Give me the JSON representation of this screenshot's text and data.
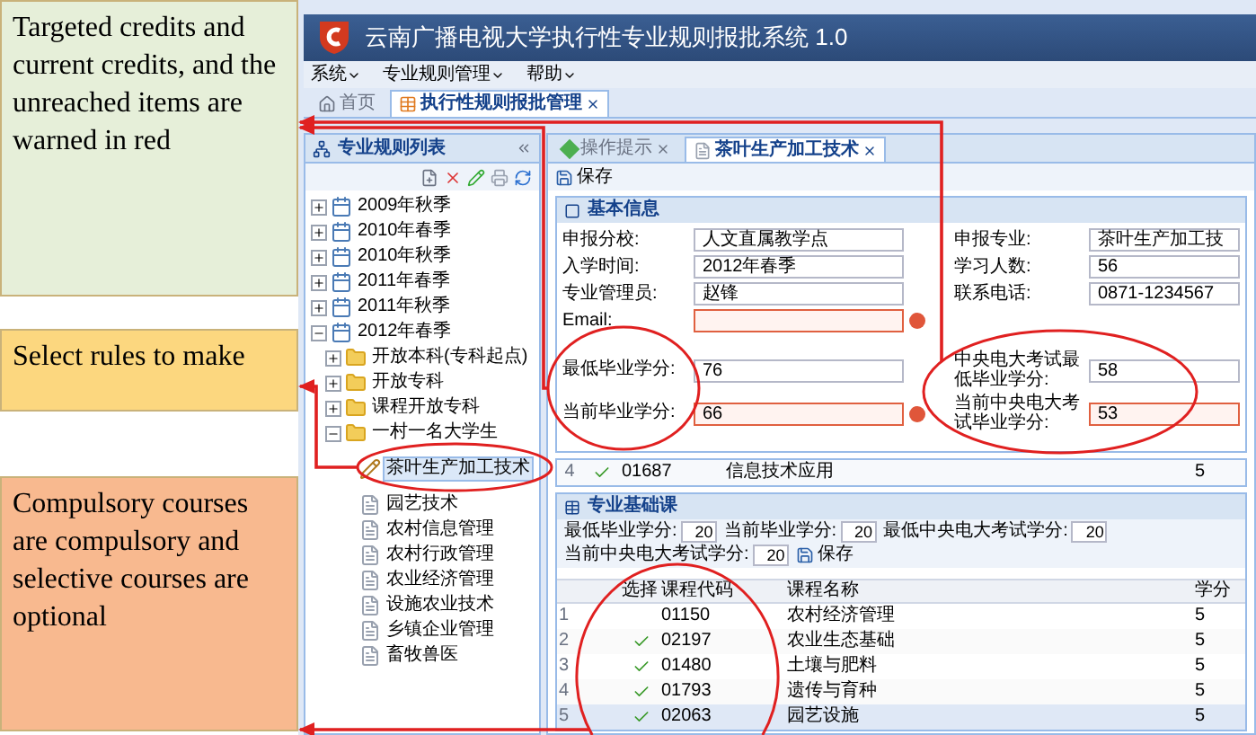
{
  "annotations": [
    {
      "text": "Targeted credits and current credits, and the unreached items are warned in red",
      "color": "#e6efd9"
    },
    {
      "text": "Select rules to make",
      "color": "#fcd77f"
    },
    {
      "text": "Compulsory courses are compulsory and selective courses are optional",
      "color": "#f8b98f"
    }
  ],
  "app": {
    "title": "云南广播电视大学执行性专业规则报批系统 1.0",
    "menu": [
      "系统",
      "专业规则管理",
      "帮助"
    ],
    "tabs": [
      {
        "label": "首页",
        "selected": false
      },
      {
        "label": "执行性规则报批管理",
        "selected": true
      }
    ],
    "left_panel": {
      "title": "专业规则列表",
      "tree": [
        {
          "label": "2009年秋季",
          "kind": "term",
          "expanded": false,
          "selected": false
        },
        {
          "label": "2010年春季",
          "kind": "term",
          "expanded": false,
          "selected": false
        },
        {
          "label": "2010年秋季",
          "kind": "term",
          "expanded": false,
          "selected": false
        },
        {
          "label": "2011年春季",
          "kind": "term",
          "expanded": false,
          "selected": false
        },
        {
          "label": "2011年秋季",
          "kind": "term",
          "expanded": false,
          "selected": false
        },
        {
          "label": "2012年春季",
          "kind": "term",
          "expanded": true,
          "selected": false,
          "children": [
            {
              "label": "开放本科(专科起点)",
              "kind": "folder",
              "expanded": false,
              "selected": false
            },
            {
              "label": "开放专科",
              "kind": "folder",
              "expanded": false,
              "selected": false
            },
            {
              "label": "课程开放专科",
              "kind": "folder",
              "expanded": false,
              "selected": false
            },
            {
              "label": "一村一名大学生",
              "kind": "folder",
              "expanded": true,
              "selected": false,
              "children": [
                {
                  "label": "茶叶生产加工技术",
                  "kind": "editing",
                  "selected": true
                },
                {
                  "label": "园艺技术",
                  "kind": "rule",
                  "selected": false
                },
                {
                  "label": "农村信息管理",
                  "kind": "rule",
                  "selected": false
                },
                {
                  "label": "农村行政管理",
                  "kind": "rule",
                  "selected": false
                },
                {
                  "label": "农业经济管理",
                  "kind": "rule",
                  "selected": false
                },
                {
                  "label": "设施农业技术",
                  "kind": "rule",
                  "selected": false
                },
                {
                  "label": "乡镇企业管理",
                  "kind": "rule",
                  "selected": false
                },
                {
                  "label": "畜牧兽医",
                  "kind": "rule",
                  "selected": false
                }
              ]
            }
          ]
        }
      ]
    },
    "main_tabs": [
      {
        "label": "操作提示",
        "selected": false
      },
      {
        "label": "茶叶生产加工技术",
        "selected": true
      }
    ],
    "save_label": "保存",
    "basic_info": {
      "title": "基本信息",
      "rows": [
        [
          {
            "label": "申报分校:",
            "value": "人文直属教学点",
            "error": false
          },
          {
            "label": "申报专业:",
            "value": "茶叶生产加工技",
            "error": false
          }
        ],
        [
          {
            "label": "入学时间:",
            "value": "2012年春季",
            "error": false
          },
          {
            "label": "学习人数:",
            "value": "56",
            "error": false
          }
        ],
        [
          {
            "label": "专业管理员:",
            "value": "赵锋",
            "error": false
          },
          {
            "label": "联系电话:",
            "value": "0871-1234567",
            "error": false
          }
        ],
        [
          {
            "label": "Email:",
            "error": true
          }
        ],
        [
          {
            "label": "最低毕业学分:",
            "value": "76",
            "error": false
          },
          {
            "label": "中央电大考试最低毕业学分:",
            "value": "58",
            "error": false
          }
        ],
        [
          {
            "label": "当前毕业学分:",
            "value": "66",
            "error": true
          },
          {
            "label": "当前中央电大考试毕业学分:",
            "value": "53",
            "error": true
          }
        ]
      ]
    },
    "prev_row": {
      "number": "4",
      "checked": true,
      "code": "01687",
      "name": "信息技术应用",
      "credit": "5"
    },
    "courses": {
      "title": "专业基础课",
      "filters": [
        {
          "label": "最低毕业学分:",
          "value": "20"
        },
        {
          "label": "当前毕业学分:",
          "value": "20"
        },
        {
          "label": "最低中央电大考试学分:",
          "value": "20"
        },
        {
          "label": "当前中央电大考试学分:",
          "value": "20"
        }
      ],
      "save_label": "保存",
      "columns": [
        "选择",
        "课程代码",
        "课程名称",
        "学分"
      ],
      "rows": [
        {
          "number": "1",
          "checked": false,
          "code": "01150",
          "name": "农村经济管理",
          "credit": "5",
          "selected": false
        },
        {
          "number": "2",
          "checked": true,
          "code": "02197",
          "name": "农业生态基础",
          "credit": "5",
          "selected": false
        },
        {
          "number": "3",
          "checked": true,
          "code": "01480",
          "name": "土壤与肥料",
          "credit": "5",
          "selected": false
        },
        {
          "number": "4",
          "checked": true,
          "code": "01793",
          "name": "遗传与育种",
          "credit": "5",
          "selected": false
        },
        {
          "number": "5",
          "checked": true,
          "code": "02063",
          "name": "园艺设施",
          "credit": "5",
          "selected": true
        }
      ]
    }
  }
}
